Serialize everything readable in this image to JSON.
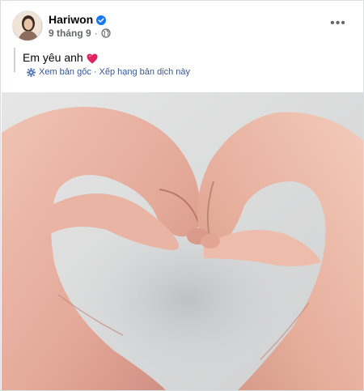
{
  "post": {
    "author": "Hariwon",
    "timestamp": "9 tháng 9",
    "caption": "Em yêu anh",
    "icons": {
      "avatar": "profile-photo",
      "verified": "verified-badge-icon",
      "privacy": "globe-icon",
      "more": "more-options-icon",
      "translate": "gear-icon",
      "heart": "red-heart-emoji"
    },
    "translation": {
      "see_original": "Xem bản gốc",
      "separator": "·",
      "rate_translation": "Xếp hạng bản dịch này"
    },
    "more_label": "•••"
  },
  "colors": {
    "link": "#385898",
    "meta": "#65676b",
    "verified": "#1877f2",
    "heart": "#e0245e"
  }
}
